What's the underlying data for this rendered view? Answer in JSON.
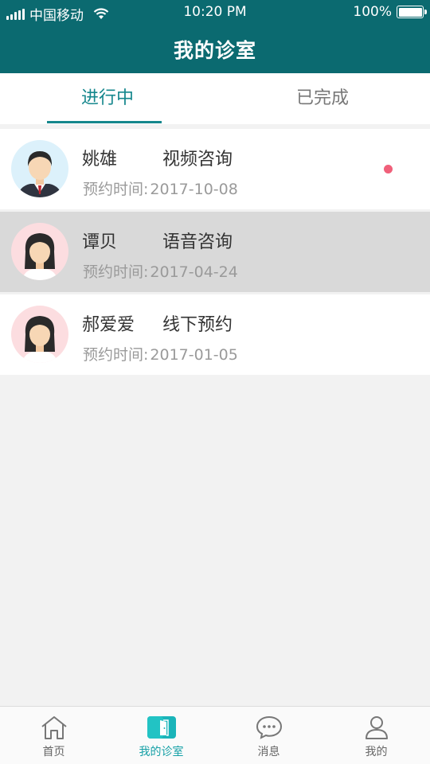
{
  "status_bar": {
    "carrier": "中国移动",
    "time": "10:20 PM",
    "battery": "100%"
  },
  "header": {
    "title": "我的诊室"
  },
  "tabs": [
    {
      "label": "进行中",
      "active": true
    },
    {
      "label": "已完成",
      "active": false
    }
  ],
  "appointments": [
    {
      "name": "姚雄",
      "service": "视频咨询",
      "time_label": "预约时间:",
      "date": "2017-10-08",
      "avatar": "male-avatar-icon",
      "unread": true
    },
    {
      "name": "谭贝",
      "service": "语音咨询",
      "time_label": "预约时间:",
      "date": "2017-04-24",
      "avatar": "female-avatar-icon",
      "unread": false
    },
    {
      "name": "郝爱爱",
      "service": "线下预约",
      "time_label": "预约时间:",
      "date": "2017-01-05",
      "avatar": "female-avatar-icon",
      "unread": false
    }
  ],
  "bottom_nav": [
    {
      "label": "首页",
      "icon": "home-icon",
      "active": false
    },
    {
      "label": "我的诊室",
      "icon": "clinic-door-icon",
      "active": true
    },
    {
      "label": "消息",
      "icon": "message-icon",
      "active": false
    },
    {
      "label": "我的",
      "icon": "profile-icon",
      "active": false
    }
  ],
  "colors": {
    "header_bg": "#0b6a70",
    "accent": "#15878d",
    "unread_dot": "#f0607a",
    "selected_row": "#d9d9d9"
  }
}
